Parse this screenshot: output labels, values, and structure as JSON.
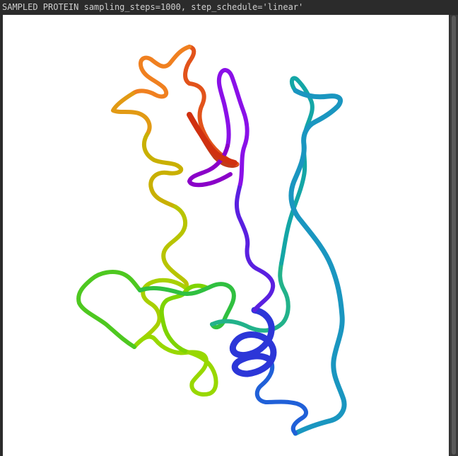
{
  "window": {
    "title": "SAMPLED PROTEIN sampling_steps=1000, step_schedule='linear'"
  },
  "colors": {
    "background": "#2b2b2b",
    "viewport": "#ffffff",
    "title_text": "#cfcfcf",
    "ribbon_gradient": [
      "#cc2200",
      "#ff7a00",
      "#c8b400",
      "#8ee000",
      "#2ed24a",
      "#14b6b0",
      "#1e74d8",
      "#2a2ee0",
      "#8a00e8"
    ]
  },
  "icons": {
    "protein": "protein-ribbon-icon"
  }
}
